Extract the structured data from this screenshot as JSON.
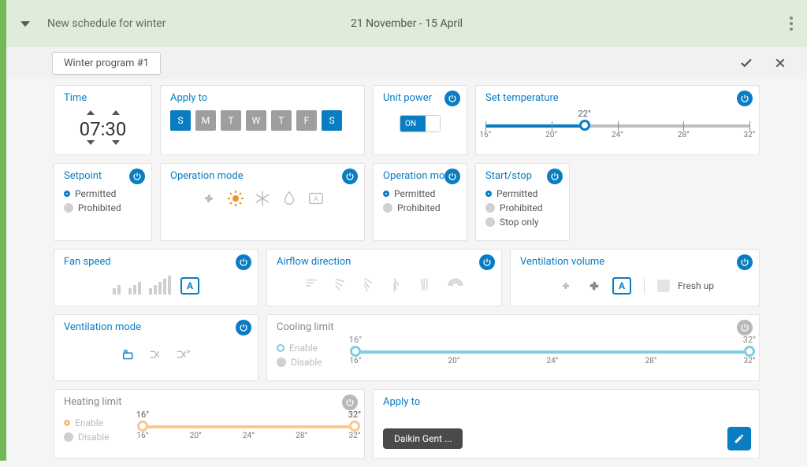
{
  "header": {
    "title": "New schedule for winter",
    "date_range": "21 November - 15 April"
  },
  "program_tab": "Winter program #1",
  "time": {
    "title": "Time",
    "value": "07:30"
  },
  "apply_days": {
    "title": "Apply to",
    "days": [
      {
        "label": "S",
        "selected": true
      },
      {
        "label": "M",
        "selected": false
      },
      {
        "label": "T",
        "selected": false
      },
      {
        "label": "W",
        "selected": false
      },
      {
        "label": "T",
        "selected": false
      },
      {
        "label": "F",
        "selected": false
      },
      {
        "label": "S",
        "selected": true
      }
    ]
  },
  "unit_power": {
    "title": "Unit power",
    "state": "ON"
  },
  "set_temp": {
    "title": "Set temperature",
    "value": "22°",
    "min": 16,
    "max": 32,
    "ticks": [
      "16°",
      "20°",
      "24°",
      "28°",
      "32°"
    ]
  },
  "setpoint": {
    "title": "Setpoint",
    "opts": [
      "Permitted",
      "Prohibited"
    ],
    "selected": 0
  },
  "op_mode_icons": {
    "title": "Operation mode"
  },
  "op_mode_perm": {
    "title": "Operation mode",
    "opts": [
      "Permitted",
      "Prohibited"
    ],
    "selected": 0
  },
  "start_stop": {
    "title": "Start/stop",
    "opts": [
      "Permitted",
      "Prohibited",
      "Stop only"
    ],
    "selected": 0
  },
  "fan_speed": {
    "title": "Fan speed"
  },
  "airflow": {
    "title": "Airflow direction"
  },
  "vent_vol": {
    "title": "Ventilation volume",
    "fresh": "Fresh up"
  },
  "vent_mode": {
    "title": "Ventilation mode"
  },
  "cool": {
    "title": "Cooling limit",
    "opts": [
      "Enable",
      "Disable"
    ],
    "selected": 0,
    "low": "16°",
    "high": "32°",
    "ticks": [
      "16°",
      "20°",
      "24°",
      "28°",
      "32°"
    ]
  },
  "heat": {
    "title": "Heating limit",
    "opts": [
      "Enable",
      "Disable"
    ],
    "selected": 0,
    "low": "16°",
    "high": "32°",
    "ticks": [
      "16°",
      "20°",
      "24°",
      "28°",
      "32°"
    ]
  },
  "apply_units": {
    "title": "Apply to",
    "chip": "Daikin Gent ..."
  }
}
